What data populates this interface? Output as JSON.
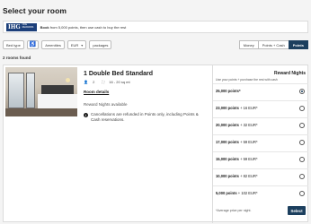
{
  "page": {
    "title": "Select your room"
  },
  "banner": {
    "logo": "IHG",
    "logo_sub": "ONE REWARDS",
    "text_bold": "Book",
    "text_rest": " from 5,000 points, then use cash to buy the rest"
  },
  "filters": {
    "bed_type": "Bed type",
    "accessible_icon": "wheelchair-icon",
    "amenities": "Amenities",
    "currency": "EUR",
    "packages": "packages"
  },
  "pay_toggle": {
    "options": [
      "Money",
      "Points + Cash",
      "Points"
    ],
    "active": "Points"
  },
  "results": {
    "count_text": "2 rooms found"
  },
  "room": {
    "title": "1 Double Bed Standard",
    "guests": "2",
    "size": "16 - 20 sq mt",
    "details_link": "Room details",
    "reward_avail": "Reward Nights available",
    "cancel_note": "Cancellations are refunded in Points only, including Points & Cash reservations."
  },
  "rates": {
    "header": "Reward Nights",
    "subheader": "Use your points + purchase the rest with cash",
    "options": [
      {
        "points": "25,000 points*",
        "cash": "",
        "selected": true
      },
      {
        "points": "23,000 points",
        "cash": " + 16 EUR*",
        "selected": false
      },
      {
        "points": "20,000 points",
        "cash": " + 32 EUR*",
        "selected": false
      },
      {
        "points": "17,000 points",
        "cash": " + 59 EUR*",
        "selected": false
      },
      {
        "points": "15,000 points",
        "cash": " + 59 EUR*",
        "selected": false
      },
      {
        "points": "10,000 points",
        "cash": " + 82 EUR*",
        "selected": false
      },
      {
        "points": "5,000 points",
        "cash": " + 102 EUR*",
        "selected": false
      }
    ],
    "footnote": "*Average price per night.",
    "select_label": "Select"
  }
}
